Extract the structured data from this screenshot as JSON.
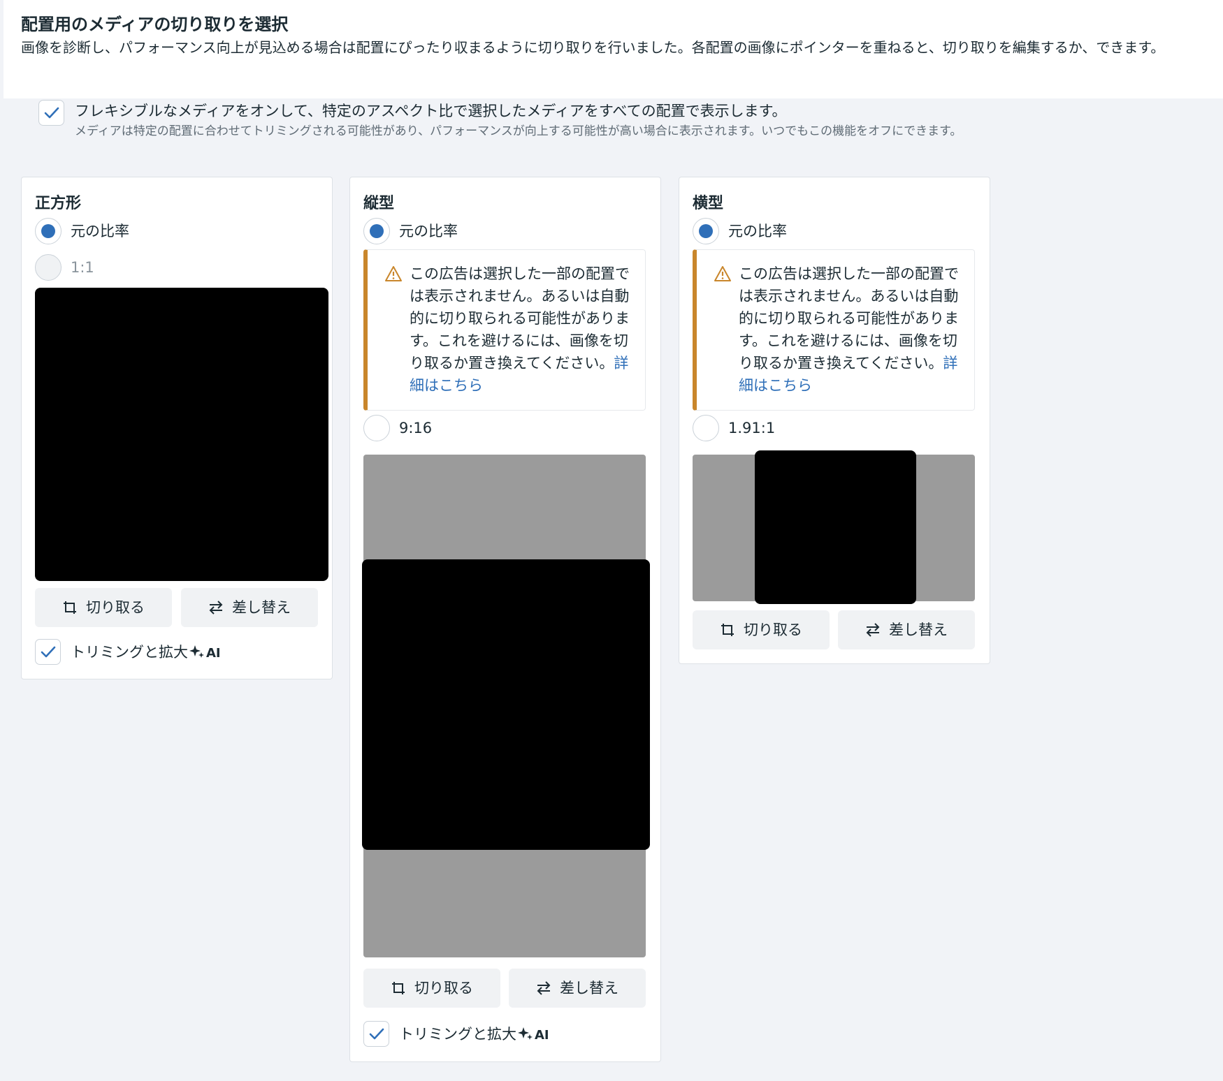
{
  "header": {
    "title": "配置用のメディアの切り取りを選択",
    "description": "画像を診断し、パフォーマンス向上が見込める場合は配置にぴったり収まるように切り取りを行いました。各配置の画像にポインターを重ねると、切り取りを編集するか、できます。"
  },
  "flexible": {
    "checked": true,
    "label": "フレキシブルなメディアをオンして、特定のアスペクト比で選択したメディアをすべての配置で表示します。",
    "sublabel": "メディアは特定の配置に合わせてトリミングされる可能性があり、パフォーマンスが向上する可能性が高い場合に表示されます。いつでもこの機能をオフにできます。"
  },
  "cards": {
    "square": {
      "title": "正方形",
      "option_original": "元の比率",
      "option_ratio": "1:1",
      "crop_label": "切り取る",
      "replace_label": "差し替え",
      "ai_label": "トリミングと拡大",
      "ai_badge": "AI",
      "ai_checked": true
    },
    "vertical": {
      "title": "縦型",
      "option_original": "元の比率",
      "warning_text": "この広告は選択した一部の配置では表示されません。あるいは自動的に切り取られる可能性があります。これを避けるには、画像を切り取るか置き換えてください。",
      "warning_link": "詳細はこちら",
      "option_ratio": "9:16",
      "crop_label": "切り取る",
      "replace_label": "差し替え",
      "ai_label": "トリミングと拡大",
      "ai_badge": "AI",
      "ai_checked": true
    },
    "horizontal": {
      "title": "横型",
      "option_original": "元の比率",
      "warning_text": "この広告は選択した一部の配置では表示されません。あるいは自動的に切り取られる可能性があります。これを避けるには、画像を切り取るか置き換えてください。",
      "warning_link": "詳細はこちら",
      "option_ratio": "1.91:1",
      "crop_label": "切り取る",
      "replace_label": "差し替え"
    }
  },
  "colors": {
    "accent": "#2f6fb8",
    "warning": "#c9862b",
    "background": "#f1f3f7",
    "media_placeholder": "#9b9b9b"
  },
  "icons": [
    "check-icon",
    "crop-icon",
    "swap-icon",
    "warning-icon",
    "sparkle-icon"
  ]
}
